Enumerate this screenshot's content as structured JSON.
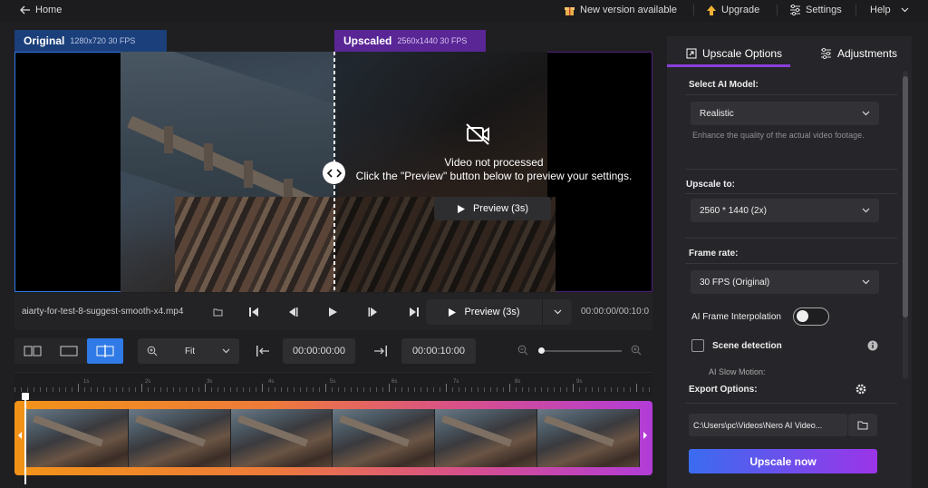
{
  "topbar": {
    "home_label": "Home",
    "new_version_label": "New version available",
    "upgrade_label": "Upgrade",
    "settings_label": "Settings",
    "help_label": "Help"
  },
  "original": {
    "label": "Original",
    "spec": "1280x720 30 FPS"
  },
  "upscaled": {
    "label": "Upscaled",
    "spec": "2560x1440 30 FPS"
  },
  "overlay": {
    "title": "Video not processed",
    "message": "Click the \"Preview\" button below to preview your settings.",
    "preview_button": "Preview (3s)"
  },
  "player": {
    "filename": "aiarty-for-test-8-suggest-smooth-x4.mp4",
    "preview_button": "Preview (3s)",
    "time": "00:00:00/00:10:0"
  },
  "toolbar": {
    "zoom_value": "Fit",
    "start_time": "00:00:00:00",
    "end_time": "00:00:10:00"
  },
  "ruler_labels": [
    "1s",
    "2s",
    "3s",
    "4s",
    "5s",
    "6s",
    "7s",
    "8s",
    "9s"
  ],
  "panel": {
    "tab_upscale": "Upscale Options",
    "tab_adjust": "Adjustments",
    "ai_model_label": "Select AI Model:",
    "ai_model_value": "Realistic",
    "ai_model_desc": "Enhance the quality of the actual video footage.",
    "upscale_to_label": "Upscale to:",
    "upscale_to_value": "2560 * 1440 (2x)",
    "frame_rate_label": "Frame rate:",
    "frame_rate_value": "30 FPS (Original)",
    "frame_interp_label": "AI Frame Interpolation",
    "frame_interp_on": false,
    "scene_detect_label": "Scene detection",
    "scene_detect_checked": false,
    "slow_motion_label": "AI Slow Motion:",
    "export_label": "Export Options:",
    "export_path": "C:\\Users\\pc\\Videos\\Nero AI Video...",
    "upscale_now": "Upscale now"
  },
  "colors": {
    "accent_blue": "#2f7ae6",
    "accent_purple": "#8a3fd8",
    "original_tag": "#1b3f7a",
    "upscaled_tag": "#5a2696"
  }
}
